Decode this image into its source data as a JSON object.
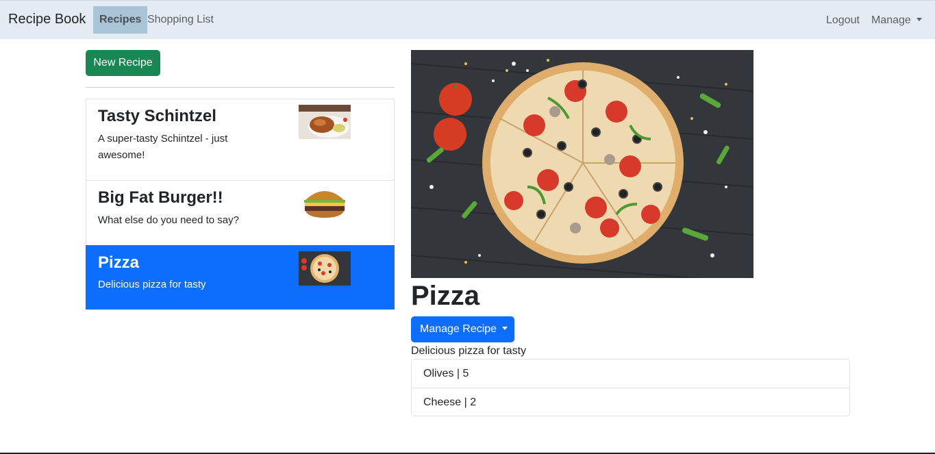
{
  "navbar": {
    "brand": "Recipe Book",
    "links": [
      "Recipes",
      "Shopping List"
    ],
    "logout": "Logout",
    "manage": "Manage"
  },
  "sidebar": {
    "new_recipe": "New Recipe",
    "recipes": [
      {
        "name": "Tasty Schintzel",
        "description": "A super-tasty Schintzel - just awesome!"
      },
      {
        "name": "Big Fat Burger!!",
        "description": "What else do you need to say?"
      },
      {
        "name": "Pizza",
        "description": "Delicious pizza for tasty"
      }
    ]
  },
  "detail": {
    "title": "Pizza",
    "manage_button": "Manage Recipe",
    "description": "Delicious pizza for tasty",
    "ingredients": [
      "Olives | 5",
      "Cheese | 2"
    ]
  },
  "colors": {
    "accent": "#0d6efd",
    "success": "#198754",
    "navbar": "#e4ebf2"
  }
}
